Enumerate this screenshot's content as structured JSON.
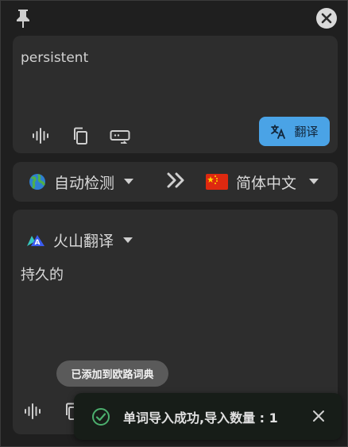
{
  "source": {
    "text": "persistent",
    "translate_label": "翻译"
  },
  "languages": {
    "from": "自动检测",
    "to": "简体中文"
  },
  "result": {
    "service": "火山翻译",
    "text": "持久的"
  },
  "tooltip": "已添加到欧路词典",
  "toast": {
    "message": "单词导入成功,导入数量 : 1"
  },
  "colors": {
    "accent": "#4aa3e6",
    "success": "#4caf6e"
  },
  "icons": [
    "pin-icon",
    "close-icon",
    "sound-icon",
    "copy-icon",
    "keyboard-icon",
    "translate-icon",
    "globe-icon",
    "china-flag-icon",
    "double-chevron-icon",
    "volcano-logo-icon",
    "check-circle-icon"
  ]
}
